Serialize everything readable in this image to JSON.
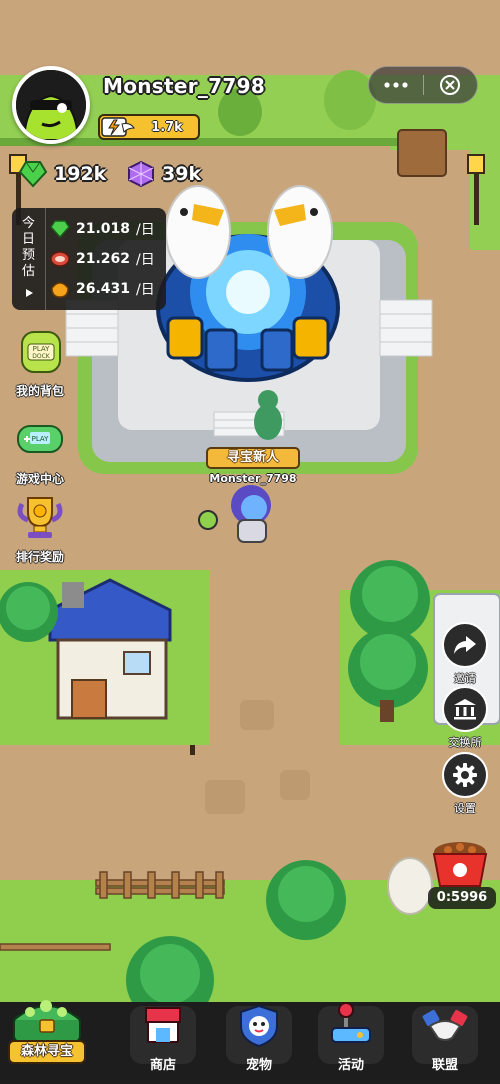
{
  "player": {
    "name": "Monster_7798",
    "level": "1.7k",
    "title": "寻宝新人",
    "character_name": "Monster_7798"
  },
  "currency": {
    "gems": "192k",
    "crystals": "39k"
  },
  "daily_estimate": {
    "label_chars": [
      "今",
      "日",
      "预",
      "估"
    ],
    "rows": [
      {
        "icon": "gem-icon",
        "value": "21.018",
        "unit": "/日"
      },
      {
        "icon": "meat-icon",
        "value": "21.262",
        "unit": "/日"
      },
      {
        "icon": "fruit-icon",
        "value": "26.431",
        "unit": "/日"
      }
    ]
  },
  "left_menu": {
    "backpack": "我的背包",
    "game_center": "游戏中心",
    "ranking": "排行奖励"
  },
  "right_menu": {
    "invite": "邀请",
    "exchange": "交换所",
    "settings": "设置"
  },
  "food_timer": "0:5996",
  "bottom_nav": {
    "home": "森林寻宝",
    "shop": "商店",
    "pets": "宠物",
    "events": "活动",
    "alliance": "联盟"
  },
  "colors": {
    "grass": "#8fcf4d",
    "path": "#c9a57c",
    "accent_gold": "#f5c12e",
    "nav_bg": "#1d1d1d"
  }
}
